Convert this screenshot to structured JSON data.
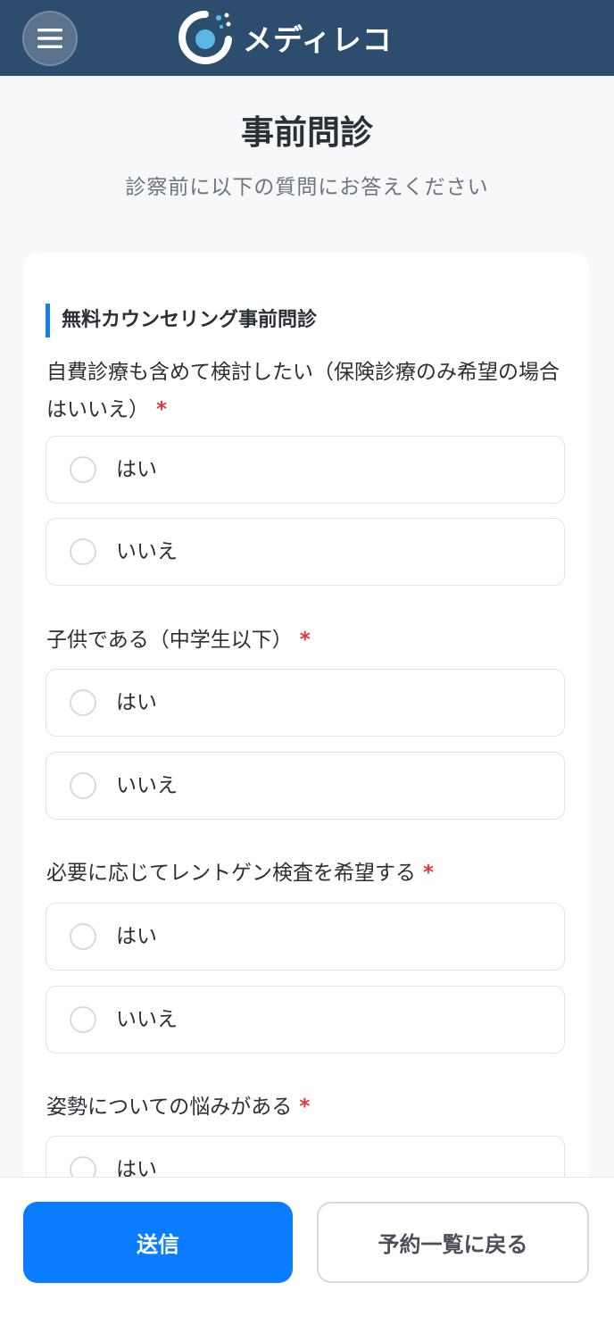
{
  "header": {
    "brand": "メディレコ",
    "menu_icon": "hamburger-icon",
    "color": "#2d4d6f"
  },
  "page": {
    "title": "事前問診",
    "subtitle": "診察前に以下の質問にお答えください"
  },
  "section": {
    "title": "無料カウンセリング事前問診"
  },
  "questions": [
    {
      "label": "自費診療も含めて検討したい（保険診療のみ希望の場合はいいえ）",
      "required": "*",
      "options": [
        "はい",
        "いいえ"
      ]
    },
    {
      "label": "子供である（中学生以下）",
      "required": "*",
      "options": [
        "はい",
        "いいえ"
      ]
    },
    {
      "label": "必要に応じてレントゲン検査を希望する",
      "required": "*",
      "options": [
        "はい",
        "いいえ"
      ]
    },
    {
      "label": "姿勢についての悩みがある",
      "required": "*",
      "options": [
        "はい"
      ]
    }
  ],
  "footer": {
    "submit_label": "送信",
    "back_label": "予約一覧に戻る"
  },
  "colors": {
    "accent": "#0a7cff",
    "required": "#e0383e"
  }
}
